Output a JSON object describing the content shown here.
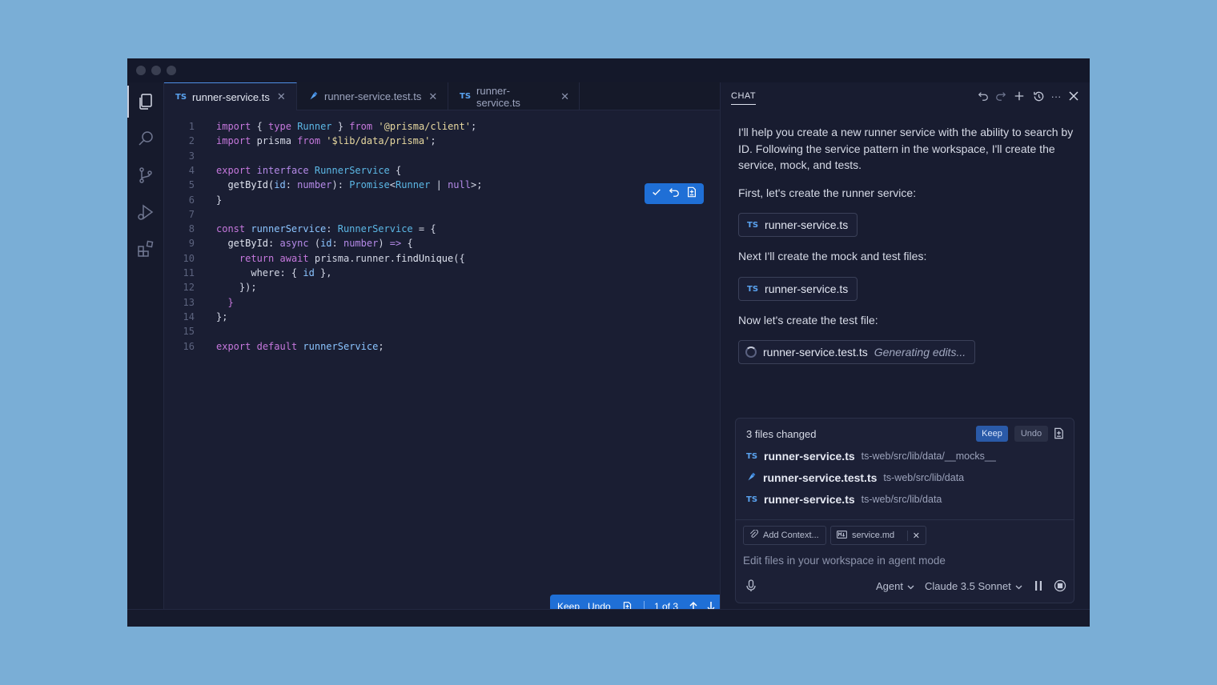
{
  "editor": {
    "tabs": [
      {
        "badge": "TS",
        "label": "runner-service.ts",
        "active": true
      },
      {
        "badge": "",
        "label": "runner-service.test.ts",
        "active": false
      },
      {
        "badge": "TS",
        "label": "runner-service.ts",
        "active": false
      }
    ],
    "lines": [
      {
        "n": "1"
      },
      {
        "n": "2"
      },
      {
        "n": "3"
      },
      {
        "n": "4"
      },
      {
        "n": "5"
      },
      {
        "n": "6"
      },
      {
        "n": "7"
      },
      {
        "n": "8"
      },
      {
        "n": "9"
      },
      {
        "n": "10"
      },
      {
        "n": "11"
      },
      {
        "n": "12"
      },
      {
        "n": "13"
      },
      {
        "n": "14"
      },
      {
        "n": "15"
      },
      {
        "n": "16"
      }
    ],
    "code": {
      "l1": [
        "import",
        " { ",
        "type",
        " ",
        "Runner",
        " } ",
        "from",
        " ",
        "'@prisma/client'",
        ";"
      ],
      "l2": [
        "import",
        " prisma ",
        "from",
        " ",
        "'$lib/data/prisma'",
        ";"
      ],
      "l4": [
        "export",
        " ",
        "interface",
        " ",
        "RunnerService",
        " {"
      ],
      "l5": [
        "  getById(",
        "id",
        ": ",
        "number",
        "): ",
        "Promise",
        "<",
        "Runner",
        " | ",
        "null",
        ">;"
      ],
      "l6": [
        "}"
      ],
      "l8": [
        "const",
        " ",
        "runnerService",
        ": ",
        "RunnerService",
        " = {"
      ],
      "l9": [
        "  getById: ",
        "async",
        " (",
        "id",
        ": ",
        "number",
        ") ",
        "=>",
        " {"
      ],
      "l10": [
        "    ",
        "return",
        " ",
        "await",
        " prisma.runner.",
        "findUnique",
        "({"
      ],
      "l11": [
        "      where: { ",
        "id",
        " },"
      ],
      "l12": [
        "    });"
      ],
      "l13": [
        "  }"
      ],
      "l14": [
        "};"
      ],
      "l16": [
        "export",
        " ",
        "default",
        " ",
        "runnerService",
        ";"
      ]
    },
    "bottom_bar": {
      "keep": "Keep",
      "undo": "Undo",
      "counter": "1 of 3"
    }
  },
  "chat": {
    "title": "CHAT",
    "messages": {
      "intro": "I'll help you create a new runner service with the ability to search by ID. Following the service pattern in the workspace, I'll create the service, mock, and tests.",
      "first": "First, let's create the runner service:",
      "next": "Next I'll create the mock and test files:",
      "now": "Now let's create the test file:"
    },
    "chips": {
      "c1": {
        "badge": "TS",
        "label": "runner-service.ts"
      },
      "c2": {
        "badge": "TS",
        "label": "runner-service.ts"
      },
      "c3": {
        "label": "runner-service.test.ts",
        "status": "Generating edits..."
      }
    },
    "changes": {
      "title": "3 files changed",
      "keep": "Keep",
      "undo": "Undo",
      "files": [
        {
          "badge": "TS",
          "name": "runner-service.ts",
          "path": "ts-web/src/lib/data/__mocks__"
        },
        {
          "badge": "",
          "name": "runner-service.test.ts",
          "path": "ts-web/src/lib/data"
        },
        {
          "badge": "TS",
          "name": "runner-service.ts",
          "path": "ts-web/src/lib/data"
        }
      ]
    },
    "composer": {
      "add_context": "Add Context...",
      "attachment": "service.md",
      "placeholder": "Edit files in your workspace in agent mode",
      "mode": "Agent",
      "model": "Claude 3.5 Sonnet"
    }
  },
  "colors": {
    "accent": "#1f6fd6",
    "background": "#7aaed6",
    "editor_bg": "#1a1e33"
  }
}
